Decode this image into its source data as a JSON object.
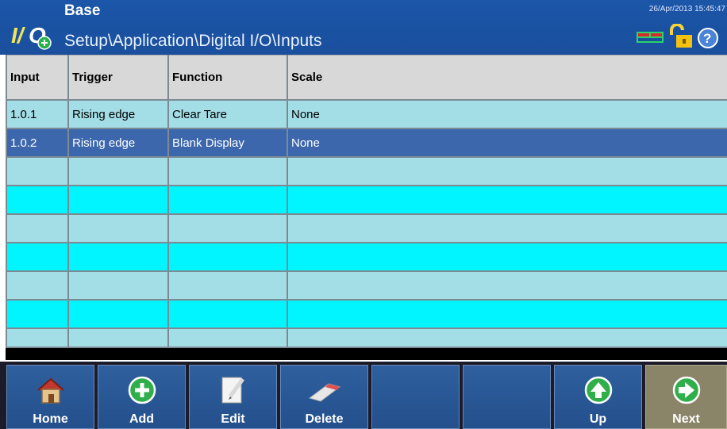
{
  "header": {
    "title": "Base",
    "path": "Setup\\Application\\Digital I/O\\Inputs",
    "datetime": "26/Apr/2013 15:45:47",
    "logo_text": "I/O"
  },
  "table": {
    "columns": [
      "Input",
      "Trigger",
      "Function",
      "Scale"
    ],
    "rows": [
      {
        "input": "1.0.1",
        "trigger": "Rising edge",
        "function": "Clear Tare",
        "scale": "None"
      },
      {
        "input": "1.0.2",
        "trigger": "Rising edge",
        "function": "Blank Display",
        "scale": "None"
      }
    ],
    "selected_row": 2
  },
  "toolbar": {
    "home": "Home",
    "add": "Add",
    "edit": "Edit",
    "delete": "Delete",
    "up": "Up",
    "next": "Next"
  },
  "colors": {
    "header_bg": "#1b56a8",
    "row_light": "#a3dde6",
    "row_cyan": "#00f5ff",
    "row_selected": "#3c67ad",
    "toolbar_btn": "#2a5795",
    "next_btn": "#8a8468"
  },
  "icons": {
    "logo": "io-logo-icon",
    "status": [
      "scale-status-icon",
      "unlock-icon",
      "help-icon"
    ],
    "home": "home-icon",
    "add": "plus-circle-icon",
    "edit": "edit-paper-icon",
    "delete": "eraser-icon",
    "up": "arrow-up-circle-icon",
    "next": "arrow-right-circle-icon"
  }
}
